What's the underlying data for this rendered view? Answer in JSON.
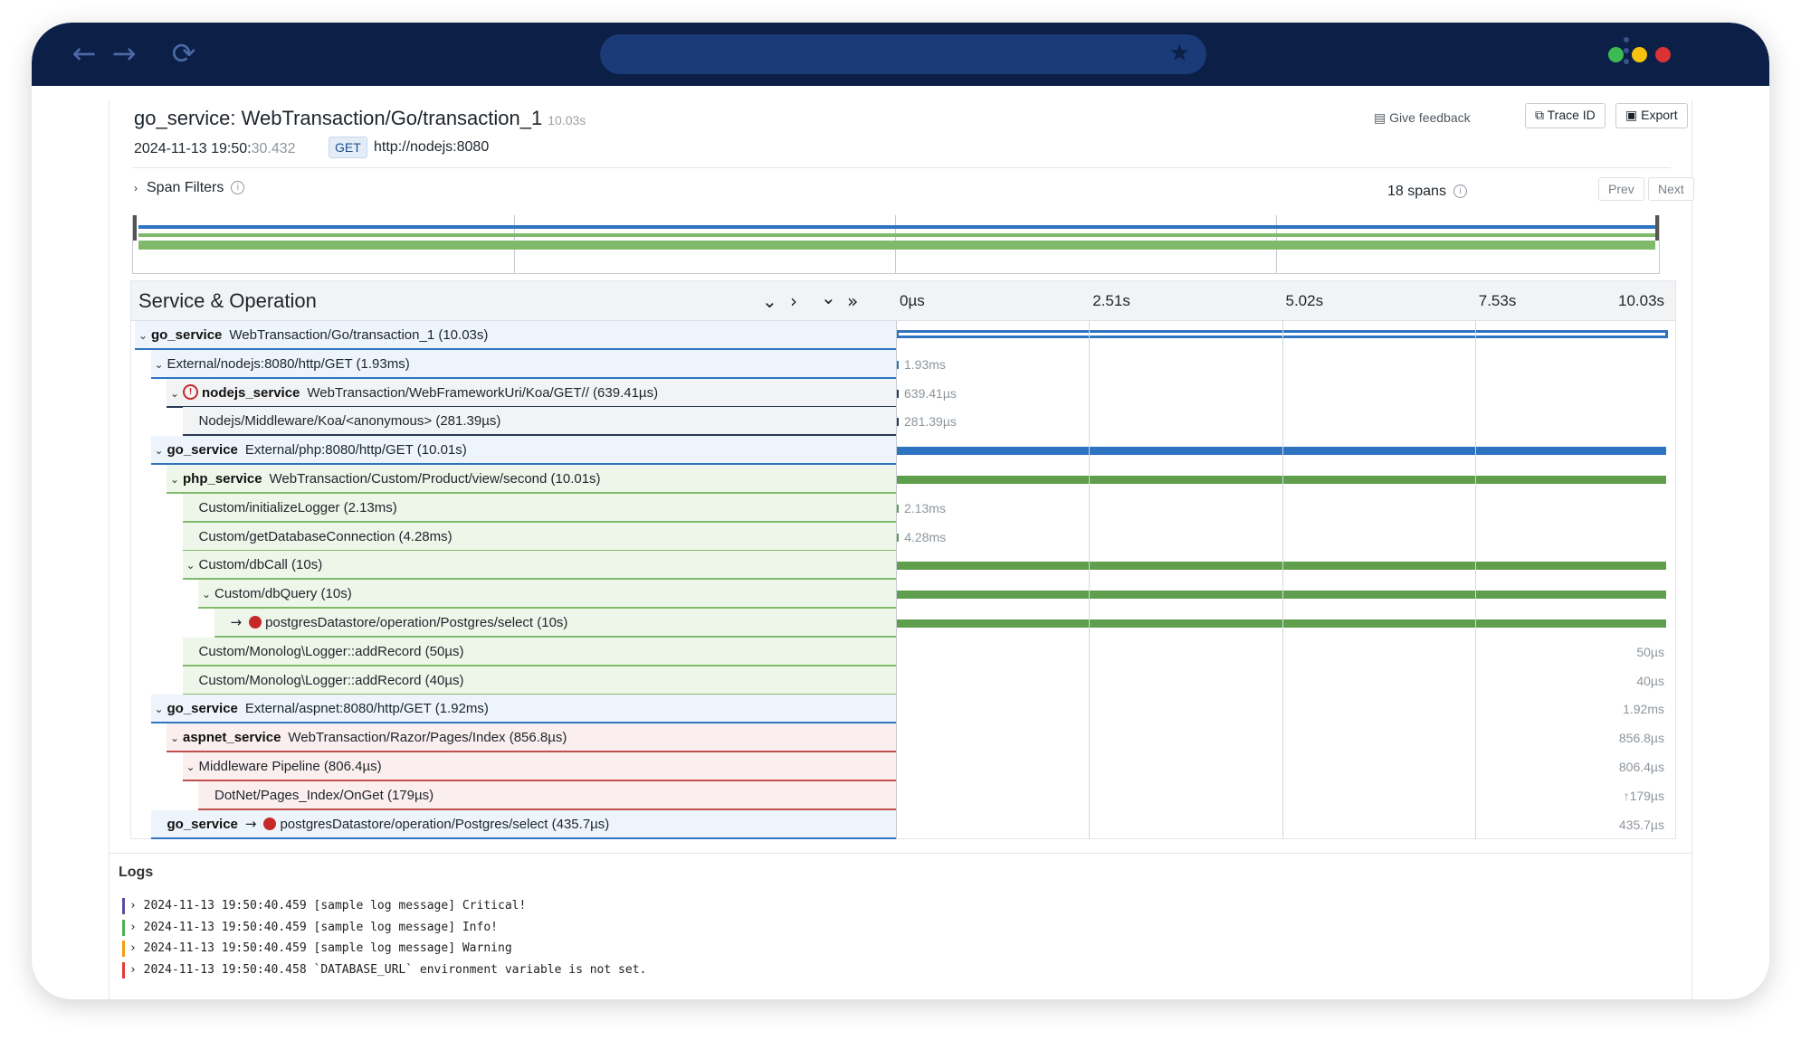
{
  "browser": {
    "back_icon": "arrow-left-icon",
    "forward_icon": "arrow-right-icon",
    "reload_icon": "reload-icon",
    "window_dots": [
      "#3cba54",
      "#f4c20d",
      "#db3236"
    ]
  },
  "header": {
    "title": "go_service: WebTransaction/Go/transaction_1",
    "duration": "10.03s",
    "timestamp_main": "2024-11-13 19:50:",
    "timestamp_ms": "30.432",
    "method": "GET",
    "url": "http://nodejs:8080",
    "feedback": "Give feedback",
    "trace_id_btn": "Trace ID",
    "export_btn": "Export"
  },
  "filters": {
    "label": "Span Filters",
    "spans": "18 spans",
    "prev": "Prev",
    "next": "Next"
  },
  "timeline": {
    "heading": "Service & Operation",
    "ticks": [
      "0µs",
      "2.51s",
      "5.02s",
      "7.53s",
      "10.03s"
    ],
    "total_s": 10.03
  },
  "spans": [
    {
      "service": "go_service",
      "op": "WebTransaction/Go/transaction_1 (10.03s)",
      "indent": 0,
      "chevron": "⌄",
      "color": "blue-outline",
      "start": 0,
      "dur": 10.03,
      "label": ""
    },
    {
      "service": "",
      "op": "External/nodejs:8080/http/GET (1.93ms)",
      "indent": 1,
      "chevron": "⌄",
      "color": "blue",
      "start": 0,
      "dur": 0.00193,
      "label": "1.93ms"
    },
    {
      "service": "nodejs_service",
      "op": "WebTransaction/WebFrameworkUri/Koa/GET// (639.41µs)",
      "indent": 2,
      "chevron": "⌄",
      "color": "gray",
      "error": true,
      "start": 0,
      "dur": 0.00064,
      "label": "639.41µs"
    },
    {
      "service": "",
      "op": "Nodejs/Middleware/Koa/<anonymous> (281.39µs)",
      "indent": 3,
      "chevron": "",
      "color": "gray",
      "start": 0,
      "dur": 0.00028,
      "label": "281.39µs"
    },
    {
      "service": "go_service",
      "op": "External/php:8080/http/GET (10.01s)",
      "indent": 1,
      "chevron": "⌄",
      "color": "blue",
      "start": 0,
      "dur": 10.01,
      "label": ""
    },
    {
      "service": "php_service",
      "op": "WebTransaction/Custom/Product/view/second (10.01s)",
      "indent": 2,
      "chevron": "⌄",
      "color": "green",
      "start": 0,
      "dur": 10.01,
      "label": ""
    },
    {
      "service": "",
      "op": "Custom/initializeLogger (2.13ms)",
      "indent": 3,
      "chevron": "",
      "color": "green",
      "start": 0,
      "dur": 0.00213,
      "label": "2.13ms"
    },
    {
      "service": "",
      "op": "Custom/getDatabaseConnection (4.28ms)",
      "indent": 3,
      "chevron": "",
      "color": "green",
      "start": 0.003,
      "dur": 0.00428,
      "label": "4.28ms"
    },
    {
      "service": "",
      "op": "Custom/dbCall (10s)",
      "indent": 3,
      "chevron": "⌄",
      "color": "green",
      "start": 0.01,
      "dur": 10.0,
      "label": ""
    },
    {
      "service": "",
      "op": "Custom/dbQuery (10s)",
      "indent": 4,
      "chevron": "⌄",
      "color": "green",
      "start": 0.01,
      "dur": 10.0,
      "label": ""
    },
    {
      "service": "",
      "op": "postgresDatastore/operation/Postgres/select (10s)",
      "indent": 5,
      "chevron": "",
      "color": "green",
      "db": true,
      "start": 0.01,
      "dur": 10.0,
      "label": ""
    },
    {
      "service": "",
      "op": "Custom/Monolog\\Logger::addRecord (50µs)",
      "indent": 3,
      "chevron": "",
      "color": "green",
      "start": 10.02,
      "dur": 5e-05,
      "label": "50µs",
      "label_right": true
    },
    {
      "service": "",
      "op": "Custom/Monolog\\Logger::addRecord (40µs)",
      "indent": 3,
      "chevron": "",
      "color": "green",
      "start": 10.02,
      "dur": 4e-05,
      "label": "40µs",
      "label_right": true
    },
    {
      "service": "go_service",
      "op": "External/aspnet:8080/http/GET (1.92ms)",
      "indent": 1,
      "chevron": "⌄",
      "color": "blue",
      "start": 10.025,
      "dur": 0.00192,
      "label": "1.92ms",
      "label_right": true
    },
    {
      "service": "aspnet_service",
      "op": "WebTransaction/Razor/Pages/Index (856.8µs)",
      "indent": 2,
      "chevron": "⌄",
      "color": "red",
      "start": 10.026,
      "dur": 0.00086,
      "label": "856.8µs",
      "label_right": true
    },
    {
      "service": "",
      "op": "Middleware Pipeline (806.4µs)",
      "indent": 3,
      "chevron": "⌄",
      "color": "red",
      "start": 10.026,
      "dur": 0.00081,
      "label": "806.4µs",
      "label_right": true
    },
    {
      "service": "",
      "op": "DotNet/Pages_Index/OnGet (179µs)",
      "indent": 4,
      "chevron": "",
      "color": "red",
      "start": 10.027,
      "dur": 0.00018,
      "label": "↑179µs",
      "label_right": true
    },
    {
      "service": "go_service",
      "op": "postgresDatastore/operation/Postgres/select (435.7µs)",
      "indent": 1,
      "chevron": "",
      "color": "blue",
      "db": true,
      "start": 10.029,
      "dur": 0.00044,
      "label": "435.7µs",
      "label_right": true
    }
  ],
  "logs": {
    "title": "Logs",
    "lines": [
      {
        "text": "› 2024-11-13 19:50:40.459 [sample log message] Critical!",
        "color": "#5c4a9e"
      },
      {
        "text": "› 2024-11-13 19:50:40.459 [sample log message] Info!",
        "color": "#4caf50"
      },
      {
        "text": "› 2024-11-13 19:50:40.459 [sample log message] Warning",
        "color": "#f39c12"
      },
      {
        "text": "› 2024-11-13 19:50:40.458 `DATABASE_URL` environment variable is not set.",
        "color": "#e53935"
      }
    ]
  },
  "colors": {
    "blue": "#2e74c0",
    "green": "#5e9e4d",
    "gray": "#2b3a55",
    "red": "#c0504d"
  }
}
